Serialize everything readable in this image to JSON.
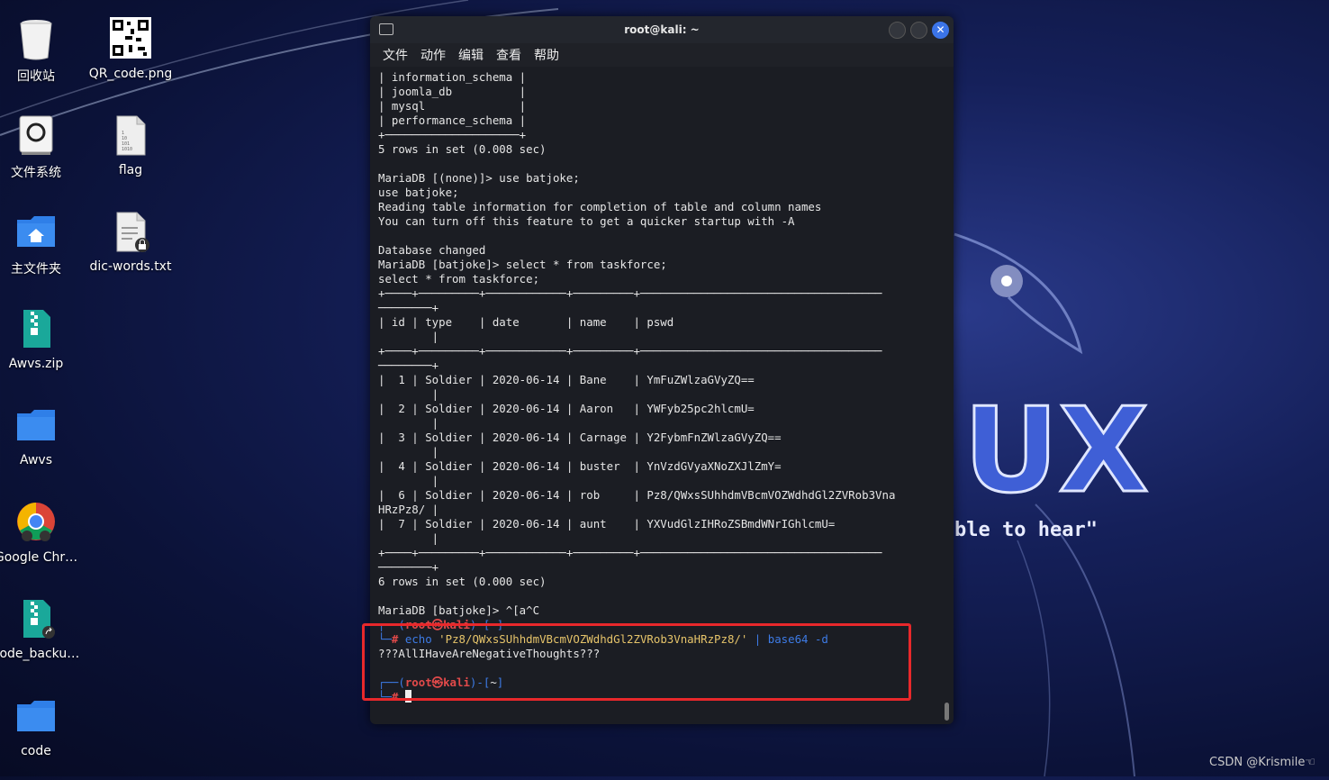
{
  "desktop": {
    "icons": [
      {
        "label": "回收站",
        "icon": "trash-icon"
      },
      {
        "label": "QR_code.png",
        "icon": "qr-image-icon"
      },
      {
        "label": "文件系统",
        "icon": "drive-icon"
      },
      {
        "label": "flag",
        "icon": "binary-file-icon"
      },
      {
        "label": "主文件夹",
        "icon": "home-folder-icon"
      },
      {
        "label": "dic-words.txt",
        "icon": "locked-text-file-icon"
      },
      {
        "label": "Awvs.zip",
        "icon": "zip-icon"
      },
      {
        "label": "Awvs",
        "icon": "folder-icon"
      },
      {
        "label": "Google Chr…",
        "icon": "chrome-icon"
      },
      {
        "label": "code_backu…",
        "icon": "zip-link-icon"
      },
      {
        "label": "code",
        "icon": "folder-icon"
      }
    ],
    "wallpaper_text": "\"the quieter you become, the more you are able to hear\"",
    "wallpaper_brand": "KALI LINUX",
    "watermark": "CSDN @Krismile☜"
  },
  "terminal": {
    "title": "root@kali: ~",
    "menu": [
      "文件",
      "动作",
      "编辑",
      "查看",
      "帮助"
    ],
    "lines": [
      "| information_schema |",
      "| joomla_db          |",
      "| mysql              |",
      "| performance_schema |",
      "+────────────────────+",
      "5 rows in set (0.008 sec)",
      "",
      "MariaDB [(none)]> use batjoke;",
      "use batjoke;",
      "Reading table information for completion of table and column names",
      "You can turn off this feature to get a quicker startup with -A",
      "",
      "Database changed",
      "MariaDB [batjoke]> select * from taskforce;",
      "select * from taskforce;",
      "+────+─────────+────────────+─────────+────────────────────────────────────",
      "────────+",
      "| id | type    | date       | name    | pswd",
      "        |",
      "+────+─────────+────────────+─────────+────────────────────────────────────",
      "────────+",
      "|  1 | Soldier | 2020-06-14 | Bane    | YmFuZWlzaGVyZQ==",
      "        |",
      "|  2 | Soldier | 2020-06-14 | Aaron   | YWFyb25pc2hlcmU=",
      "        |",
      "|  3 | Soldier | 2020-06-14 | Carnage | Y2FybmFnZWlzaGVyZQ==",
      "        |",
      "|  4 | Soldier | 2020-06-14 | buster  | YnVzdGVyaXNoZXJlZmY=",
      "        |",
      "|  6 | Soldier | 2020-06-14 | rob     | Pz8/QWxsSUhhdmVBcmVOZWdhdGl2ZVRob3Vna",
      "HRzPz8/ |",
      "|  7 | Soldier | 2020-06-14 | aunt    | YXVudGlzIHRoZSBmdWNrIGhlcmU=",
      "        |",
      "+────+─────────+────────────+─────────+────────────────────────────────────",
      "────────+",
      "6 rows in set (0.000 sec)",
      "",
      "MariaDB [batjoke]> ^[a^C"
    ],
    "prompt": {
      "user": "root㉿kali",
      "dir": "~",
      "command": "echo",
      "argument": "'Pz8/QWxsSUhhdmVBcmVOZWdhdGl2ZVRob3VnaHRzPz8/'",
      "pipe": "|",
      "command2": "base64 -d"
    },
    "output": "???AllIHaveAreNegativeThoughts???",
    "prompt2": {
      "user": "root㉿kali",
      "dir": "~"
    }
  }
}
